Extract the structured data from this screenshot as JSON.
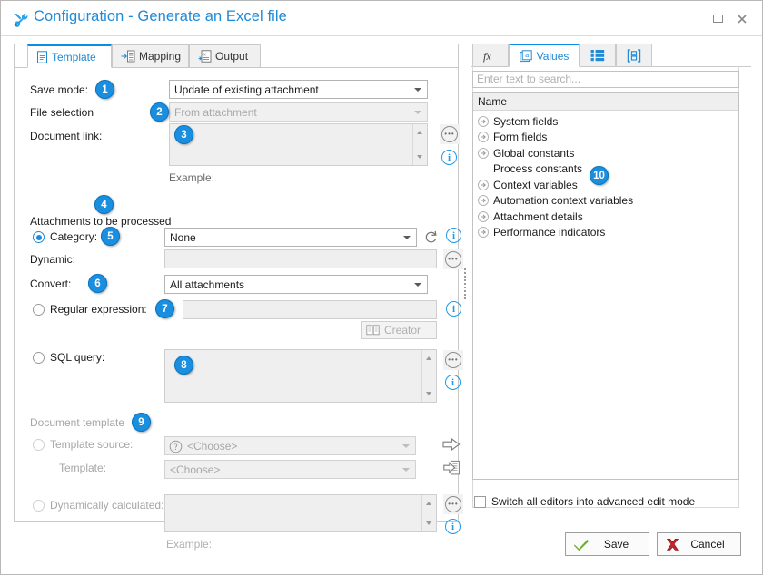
{
  "window": {
    "title": "Configuration - Generate an Excel file",
    "icon": "tools-icon",
    "maximize_label": "Maximize",
    "close_label": "Close"
  },
  "left_tabs": [
    {
      "label": "Template",
      "icon": "document-icon",
      "active": true
    },
    {
      "label": "Mapping",
      "icon": "mapping-icon",
      "active": false
    },
    {
      "label": "Output",
      "icon": "excel-icon",
      "active": false
    }
  ],
  "form": {
    "save_mode": {
      "label": "Save mode:",
      "value": "Update of existing attachment",
      "badge": "1"
    },
    "file_selection": {
      "label": "File selection",
      "value": "From attachment",
      "badge": "2",
      "disabled": true
    },
    "document_link": {
      "label": "Document link:",
      "value": "",
      "badge": "3"
    },
    "document_link_example": {
      "label": "Example:"
    },
    "attachments_section": {
      "label": "Attachments to be processed",
      "badge": "4"
    },
    "category": {
      "label": "Category:",
      "value": "None",
      "badge": "5",
      "selected": true
    },
    "dynamic": {
      "label": "Dynamic:",
      "value": ""
    },
    "convert": {
      "label": "Convert:",
      "value": "All attachments",
      "badge": "6"
    },
    "regular_expression": {
      "label": "Regular expression:",
      "value": "",
      "badge": "7",
      "selected": false
    },
    "creator_button": {
      "label": "Creator",
      "icon": "book-icon"
    },
    "sql_query": {
      "label": "SQL query:",
      "value": "",
      "badge": "8",
      "selected": false
    },
    "document_template_section": {
      "label": "Document template",
      "badge": "9"
    },
    "template_source": {
      "label": "Template source:",
      "value": "<Choose>",
      "icon": "question-icon",
      "selected": false
    },
    "template": {
      "label": "Template:",
      "value": "<Choose>"
    },
    "dynamically_calculated": {
      "label": "Dynamically calculated:",
      "value": "",
      "selected": false
    },
    "dynamic_example": {
      "label": "Example:"
    }
  },
  "right_tabs": [
    {
      "label": "",
      "icon": "fx-icon",
      "active": false
    },
    {
      "label": "Values",
      "icon": "a-box-icon",
      "active": true
    },
    {
      "label": "",
      "icon": "list-icon",
      "active": false
    },
    {
      "label": "",
      "icon": "bracket-box-icon",
      "active": false
    }
  ],
  "right_panel": {
    "search_placeholder": "Enter text to search...",
    "search_value": "",
    "column_header": "Name",
    "badge": "10",
    "tree_items": [
      {
        "label": "System fields",
        "expandable": true
      },
      {
        "label": "Form fields",
        "expandable": true
      },
      {
        "label": "Global constants",
        "expandable": true
      },
      {
        "label": "Process constants",
        "expandable": false
      },
      {
        "label": "Context variables",
        "expandable": true
      },
      {
        "label": "Automation context variables",
        "expandable": true
      },
      {
        "label": "Attachment details",
        "expandable": true
      },
      {
        "label": "Performance indicators",
        "expandable": true
      }
    ],
    "advanced_mode_checkbox": {
      "label": "Switch all editors into advanced edit mode",
      "checked": false
    }
  },
  "footer": {
    "save_label": "Save",
    "cancel_label": "Cancel"
  },
  "colors": {
    "accent": "#1f8ad6",
    "badge": "#1a8fe0",
    "tab_active_top": "#0c8ce3",
    "save_check": "#6cae2a",
    "cancel_x": "#c9252b"
  }
}
